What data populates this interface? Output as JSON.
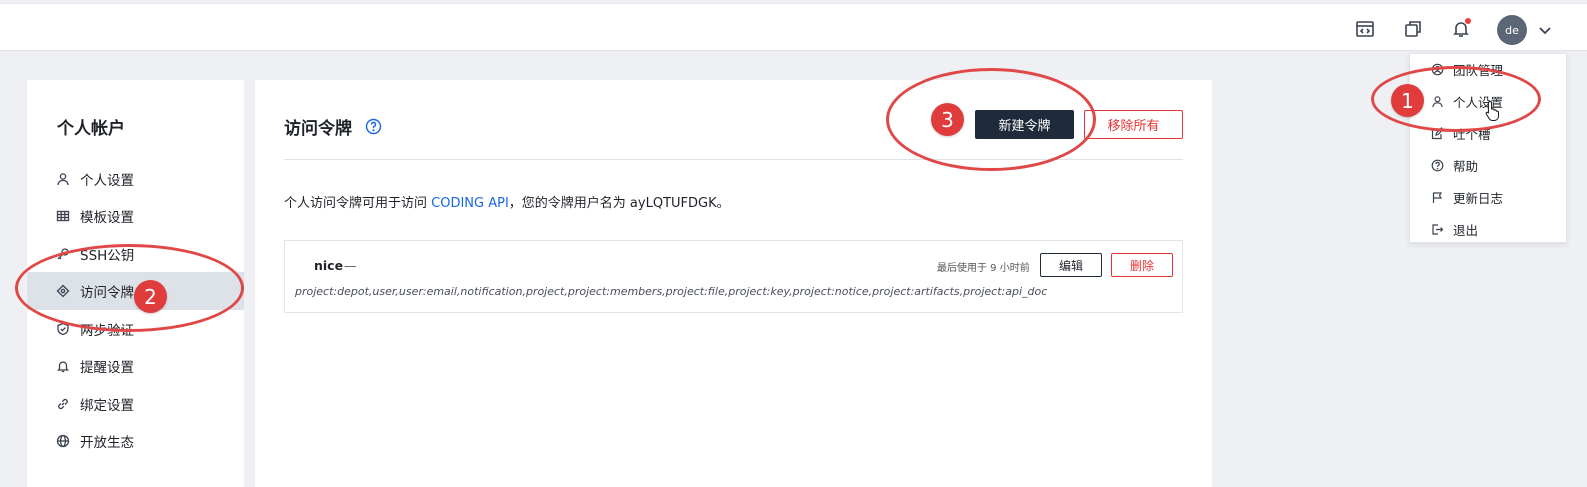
{
  "topbar": {
    "icons": [
      "workspace-icon",
      "windows-icon",
      "bell-icon"
    ],
    "avatar_text": "de"
  },
  "sidebar": {
    "title": "个人帐户",
    "items": [
      {
        "label": "个人设置",
        "icon": "user-icon"
      },
      {
        "label": "模板设置",
        "icon": "grid-icon"
      },
      {
        "label": "SSH公钥",
        "icon": "key-icon"
      },
      {
        "label": "访问令牌",
        "icon": "token-icon",
        "active": true
      },
      {
        "label": "两步验证",
        "icon": "shield-icon"
      },
      {
        "label": "提醒设置",
        "icon": "bell-icon"
      },
      {
        "label": "绑定设置",
        "icon": "link-icon"
      },
      {
        "label": "开放生态",
        "icon": "globe-icon"
      }
    ]
  },
  "main": {
    "title": "访问令牌",
    "new_button": "新建令牌",
    "remove_all_button": "移除所有",
    "desc_prefix": "个人访问令牌可用于访问 ",
    "desc_link": "CODING API",
    "desc_suffix": "，您的令牌用户名为 ayLQTUFDGK。",
    "token": {
      "name": "nice",
      "dash": "—",
      "last_used": "最后使用于 9 小时前",
      "edit": "编辑",
      "delete": "删除",
      "scopes": "project:depot,user,user:email,notification,project,project:members,project:file,project:key,project:notice,project:artifacts,project:api_doc"
    }
  },
  "dropdown": {
    "items": [
      {
        "label": "团队管理",
        "icon": "team-icon"
      },
      {
        "label": "个人设置",
        "icon": "user-icon"
      },
      {
        "label": "吐个槽",
        "icon": "feedback-icon"
      },
      {
        "label": "帮助",
        "icon": "help-icon"
      },
      {
        "label": "更新日志",
        "icon": "flag-icon"
      },
      {
        "label": "退出",
        "icon": "logout-icon"
      }
    ]
  },
  "annotations": {
    "badge1": "1",
    "badge2": "2",
    "badge3": "3",
    "color": "#e04848"
  },
  "colors": {
    "accent": "#1a66e0",
    "danger": "#e53535",
    "primary_button": "#1f2a3c"
  }
}
